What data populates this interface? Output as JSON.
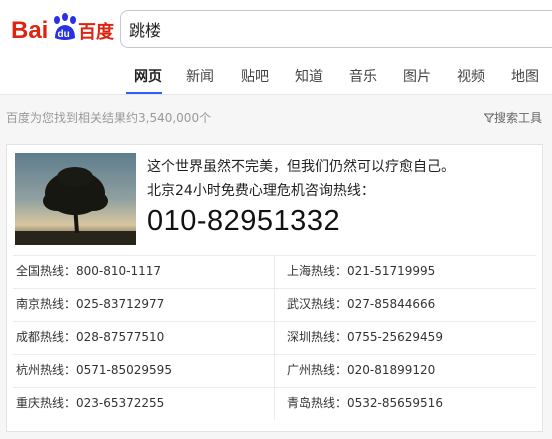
{
  "logo": {
    "text_left": "Bai",
    "text_paw": "du",
    "text_right": "百度"
  },
  "search": {
    "value": "跳楼"
  },
  "nav": {
    "tabs": [
      "网页",
      "新闻",
      "贴吧",
      "知道",
      "音乐",
      "图片",
      "视频",
      "地图"
    ],
    "active": "网页"
  },
  "result_count": "百度为您找到相关结果约3,540,000个",
  "search_tools": "搜索工具",
  "card": {
    "line1": "这个世界虽然不完美，但我们仍然可以疗愈自己。",
    "line2": "北京24小时免费心理危机咨询热线：",
    "hotline": "010-82951332",
    "hotlines": [
      {
        "left": "全国热线：800-810-1117",
        "right": "上海热线：021-51719995"
      },
      {
        "left": "南京热线：025-83712977",
        "right": "武汉热线：027-85844666"
      },
      {
        "left": "成都热线：028-87577510",
        "right": "深圳热线：0755-25629459"
      },
      {
        "left": "杭州热线：0571-85029595",
        "right": "广州热线：020-81899120"
      },
      {
        "left": "重庆热线：023-65372255",
        "right": "青岛热线：0532-85659516"
      }
    ]
  },
  "colors": {
    "baidu_red": "#de2310",
    "baidu_blue": "#2932e1",
    "tab_underline": "#315efb"
  }
}
